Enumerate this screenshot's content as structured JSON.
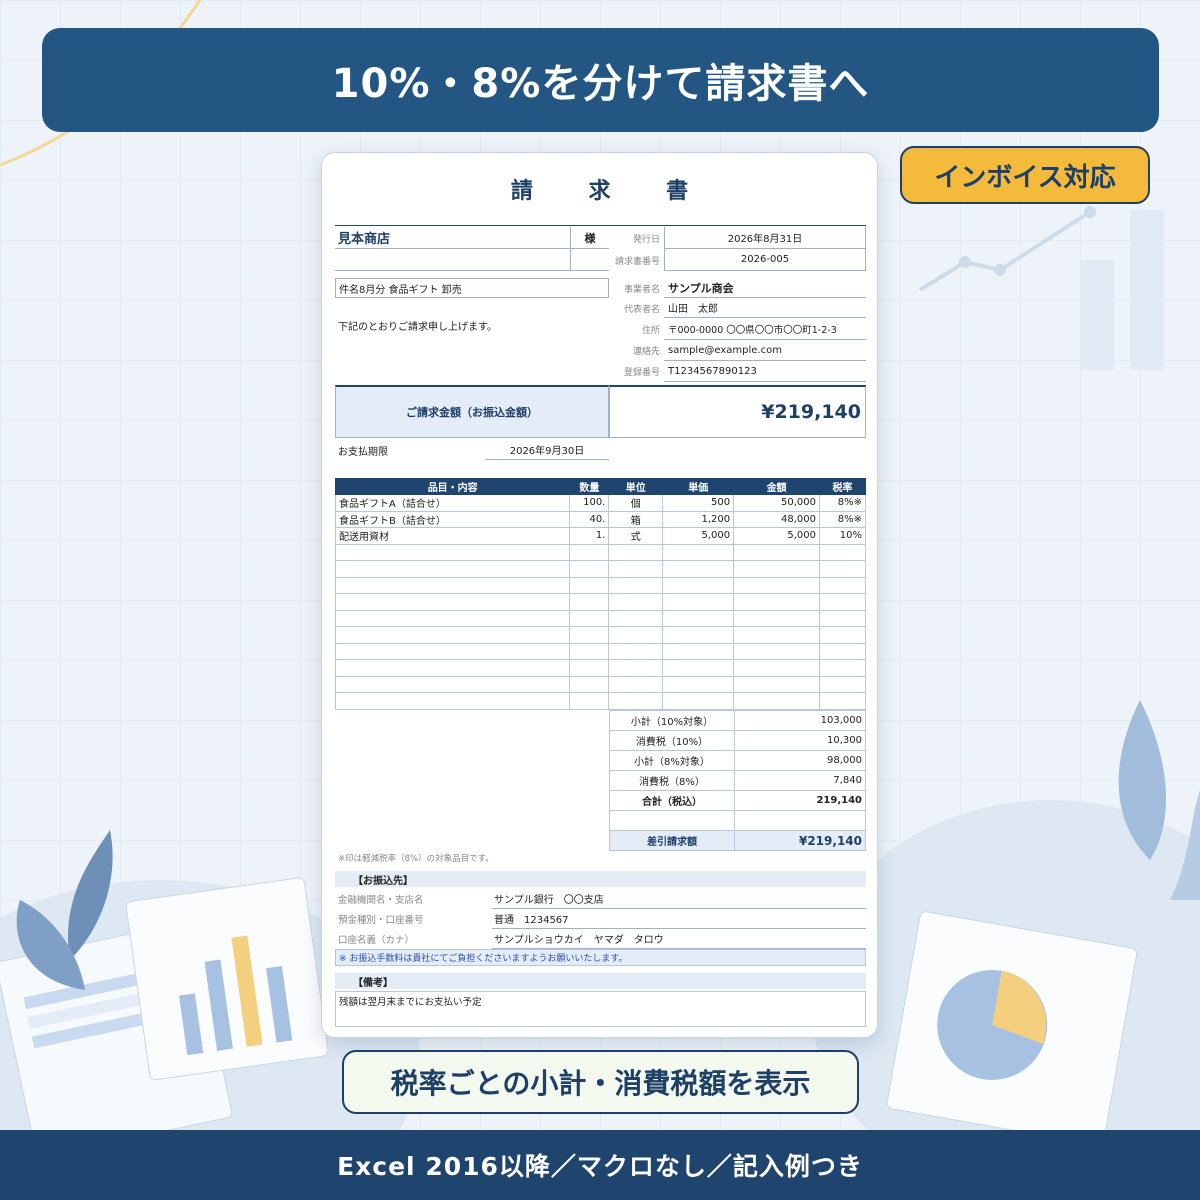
{
  "banner": {
    "title": "10%・8%を分けて請求書へ"
  },
  "badge": {
    "label": "インボイス対応"
  },
  "sub_label": {
    "text": "税率ごとの小計・消費税額を表示"
  },
  "footer": {
    "text": "Excel 2016以降／マクロなし／記入例つき"
  },
  "invoice": {
    "title": "請 求 書",
    "client_name": "見本商店",
    "honorific": "様",
    "issue_date_label": "発行日",
    "issue_date": "2026年8月31日",
    "invoice_no_label": "請求書番号",
    "invoice_no": "2026-005",
    "subject": "件名8月分 食品ギフト 卸売",
    "message": "下記のとおりご請求申し上げます。",
    "seller": {
      "company_label": "事業者名",
      "company": "サンプル商会",
      "rep_label": "代表者名",
      "rep": "山田　太郎",
      "address_label": "住所",
      "address": "〒000-0000 〇〇県〇〇市〇〇町1-2-3",
      "contact_label": "連絡先",
      "contact": "sample@example.com",
      "reg_label": "登録番号",
      "reg_no": "T1234567890123"
    },
    "amount_label": "ご請求金額（お振込金額）",
    "amount": "¥219,140",
    "due_label": "お支払期限",
    "due_date": "2026年9月30日",
    "table_headers": [
      "品目・内容",
      "数量",
      "単位",
      "単価",
      "金額",
      "税率"
    ],
    "items": [
      {
        "name": "食品ギフトA（詰合せ）",
        "qty": "100.",
        "unit": "個",
        "price": "500",
        "amount": "50,000",
        "rate": "8%※"
      },
      {
        "name": "食品ギフトB（詰合せ）",
        "qty": "40.",
        "unit": "箱",
        "price": "1,200",
        "amount": "48,000",
        "rate": "8%※"
      },
      {
        "name": "配送用資材",
        "qty": "1.",
        "unit": "式",
        "price": "5,000",
        "amount": "5,000",
        "rate": "10%"
      }
    ],
    "totals": [
      {
        "label": "小計（10%対象）",
        "value": "103,000"
      },
      {
        "label": "消費税（10%）",
        "value": "10,300"
      },
      {
        "label": "小計（8%対象）",
        "value": "98,000"
      },
      {
        "label": "消費税（8%）",
        "value": "7,840"
      },
      {
        "label": "合計（税込）",
        "value": "219,140"
      }
    ],
    "balance_label": "差引請求額",
    "balance": "¥219,140",
    "note_reduced": "※印は軽減税率（8%）の対象品目です。",
    "bank_title": "【お振込先】",
    "bank": [
      {
        "label": "金融機関名・支店名",
        "value": "サンプル銀行　〇〇支店"
      },
      {
        "label": "預金種別・口座番号",
        "value": "普通　1234567"
      },
      {
        "label": "口座名義（カナ）",
        "value": "サンプルショウカイ　ヤマダ　タロウ"
      }
    ],
    "bank_note": "※ お振込手数料は貴社にてご負担くださいますようお願いいたします。",
    "remarks_title": "【備考】",
    "remarks": "残額は翌月末までにお支払い予定"
  },
  "colors": {
    "navy": "#235683",
    "accent": "#f4ba3c",
    "footer": "#1f446d"
  }
}
